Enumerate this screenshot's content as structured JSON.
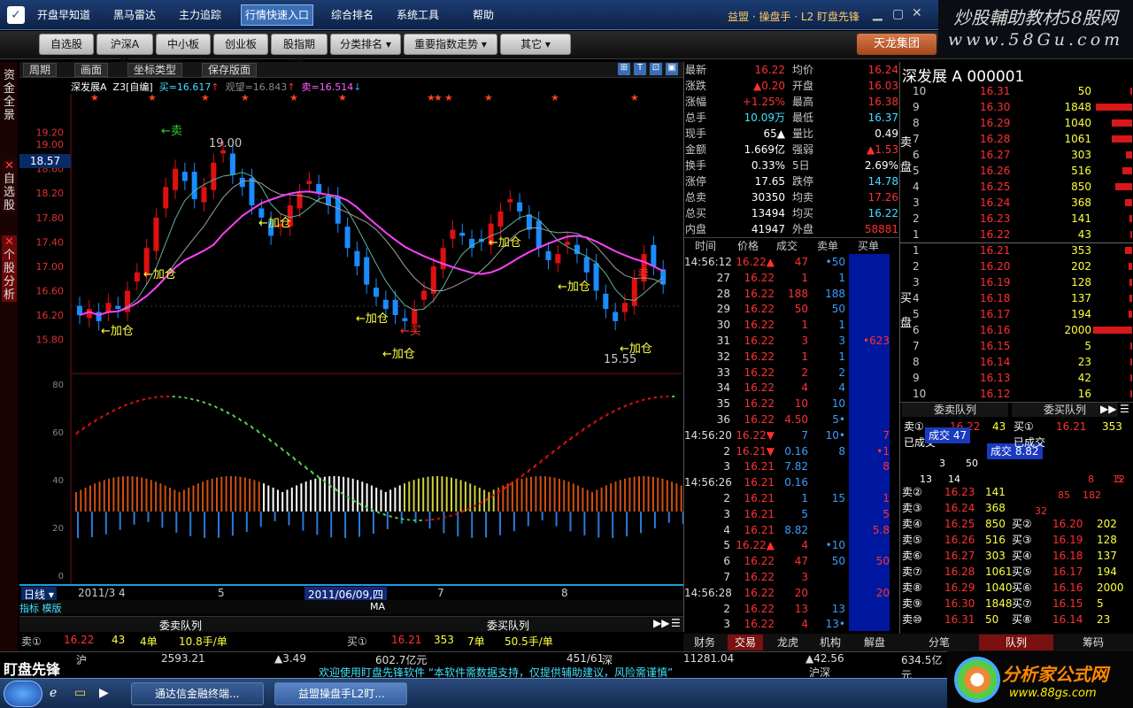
{
  "menu": {
    "items": [
      "开盘早知道",
      "黑马雷达",
      "主力追踪",
      "行情快速入口",
      "综合排名",
      "系统工具",
      "帮助"
    ],
    "active": "行情快速入口",
    "title": "益盟 · 操盘手 · L2 盯盘先锋"
  },
  "toolbar": {
    "buttons": [
      "自选股",
      "沪深A股",
      "中小板",
      "创业板",
      "股指期货",
      "分类排名 ▾",
      "重要指数走势 ▾",
      "其它 ▾"
    ],
    "brand": "天龙集团"
  },
  "watermark": {
    "line1": "炒股輔助教材58股网",
    "line2": "www.58Gu.com"
  },
  "side_tabs": [
    "资金全景",
    "自选股",
    "个股分析"
  ],
  "chart_bar": {
    "buttons": [
      "周期",
      "画面",
      "坐标类型",
      "保存版面"
    ]
  },
  "chart_info": {
    "name": "深发展A",
    "indicator": "Z3[自编]",
    "buy": "买=16.617",
    "watch": "观望=16.843",
    "sell": "卖=16.514"
  },
  "chart_data": {
    "type": "candlestick",
    "ylim": [
      15.3,
      19.8
    ],
    "yticks": [
      "19.20",
      "19.00",
      "18.80",
      "18.60",
      "18.40",
      "18.20",
      "18.00",
      "17.80",
      "17.60",
      "17.40",
      "17.20",
      "17.00",
      "16.80",
      "16.60",
      "16.40",
      "16.20",
      "16.00",
      "15.80",
      "15.60",
      "15.40"
    ],
    "price_label": "18.57",
    "annotations": [
      {
        "text": "←卖",
        "color": "#30d030"
      },
      {
        "text": "19.00",
        "color": "#c8c8c8"
      },
      {
        "text": "←加仓",
        "color": "#ffff40"
      },
      {
        "text": "←加仓",
        "color": "#ffff40"
      },
      {
        "text": "←加仓",
        "color": "#ffff40"
      },
      {
        "text": "←加仓",
        "color": "#ffff40"
      },
      {
        "text": "←加仓",
        "color": "#ffff40"
      },
      {
        "text": "←加仓",
        "color": "#ffff40"
      },
      {
        "text": "←加仓",
        "color": "#ffff40"
      },
      {
        "text": "←买",
        "color": "#ff3030"
      },
      {
        "text": "←加仓",
        "color": "#ffff40"
      },
      {
        "text": "15.55",
        "color": "#c8c8c8"
      },
      {
        "text": "卖",
        "color": "#ff3030"
      }
    ],
    "closes": [
      16.2,
      16.3,
      16.1,
      16.4,
      16.3,
      16.6,
      16.9,
      17.3,
      17.8,
      18.3,
      18.6,
      18.4,
      18.1,
      18.3,
      18.7,
      18.9,
      18.5,
      18.3,
      18.0,
      17.8,
      17.5,
      17.7,
      18.0,
      18.2,
      18.4,
      18.2,
      18.0,
      17.7,
      17.3,
      17.0,
      16.7,
      16.5,
      16.3,
      16.2,
      16.1,
      16.3,
      16.6,
      17.0,
      17.3,
      17.6,
      17.5,
      17.3,
      17.4,
      17.7,
      17.9,
      18.1,
      17.9,
      17.6,
      17.3,
      17.1,
      17.2,
      17.4,
      17.2,
      16.9,
      16.6,
      16.3,
      16.1,
      16.4,
      16.8,
      17.2,
      17.0,
      16.7
    ],
    "sub_yticks": [
      "80",
      "60",
      "40",
      "20",
      "0"
    ]
  },
  "date_bar": {
    "labels": [
      "日线 ▾",
      "2011/3",
      "4",
      "5",
      "2011/06/09,四",
      "7",
      "8"
    ]
  },
  "sub_bar": {
    "left": "指标 模版",
    "center": "MA"
  },
  "queue_bottom": {
    "sell_title": "委卖队列",
    "buy_title": "委买队列",
    "sell_row": [
      "卖①",
      "16.22",
      "43",
      "4单",
      "10.8手/单"
    ],
    "buy_row": [
      "买①",
      "16.21",
      "353",
      "7单",
      "50.5手/单"
    ]
  },
  "quote": {
    "rows": [
      {
        "k": "最新",
        "v": "16.22",
        "k2": "均价",
        "v2": "16.24"
      },
      {
        "k": "涨跌",
        "v": "▲0.20",
        "k2": "开盘",
        "v2": "16.03"
      },
      {
        "k": "涨幅",
        "v": "+1.25%",
        "k2": "最高",
        "v2": "16.38"
      },
      {
        "k": "总手",
        "v": "10.09万",
        "k2": "最低",
        "v2": "16.37"
      },
      {
        "k": "现手",
        "v": "65▲",
        "k2": "量比",
        "v2": "0.49"
      },
      {
        "k": "金额",
        "v": "1.669亿",
        "k2": "强弱",
        "v2": "▲1.53"
      },
      {
        "k": "换手",
        "v": "0.33%",
        "k2": "5日",
        "v2": "2.69%"
      },
      {
        "k": "涨停",
        "v": "17.65",
        "k2": "跌停",
        "v2": "14.78"
      },
      {
        "k": "总卖",
        "v": "30350",
        "k2": "均卖",
        "v2": "17.26"
      },
      {
        "k": "总买",
        "v": "13494",
        "k2": "均买",
        "v2": "16.22"
      },
      {
        "k": "内盘",
        "v": "41947",
        "k2": "外盘",
        "v2": "58881"
      }
    ]
  },
  "ticks": {
    "headers": [
      "时间",
      "价格",
      "成交",
      "卖单",
      "买单"
    ],
    "rows": [
      {
        "t": "14:56:12",
        "p": "16.22▲",
        "v": "47",
        "s": "•50",
        "b": ""
      },
      {
        "t": "27",
        "p": "16.22",
        "v": "1",
        "s": "1",
        "b": ""
      },
      {
        "t": "28",
        "p": "16.22",
        "v": "188",
        "s": "188",
        "b": ""
      },
      {
        "t": "29",
        "p": "16.22",
        "v": "50",
        "s": "50",
        "b": ""
      },
      {
        "t": "30",
        "p": "16.22",
        "v": "1",
        "s": "1",
        "b": ""
      },
      {
        "t": "31",
        "p": "16.22",
        "v": "3",
        "s": "3",
        "b": "•623"
      },
      {
        "t": "32",
        "p": "16.22",
        "v": "1",
        "s": "1",
        "b": ""
      },
      {
        "t": "33",
        "p": "16.22",
        "v": "2",
        "s": "2",
        "b": ""
      },
      {
        "t": "34",
        "p": "16.22",
        "v": "4",
        "s": "4",
        "b": ""
      },
      {
        "t": "35",
        "p": "16.22",
        "v": "10",
        "s": "10",
        "b": ""
      },
      {
        "t": "36",
        "p": "16.22",
        "v": "4.50",
        "s": "5•",
        "b": ""
      },
      {
        "t": "14:56:20",
        "p": "16.22▼",
        "v": "7",
        "s": "10•",
        "b": "7"
      },
      {
        "t": "2",
        "p": "16.21▼",
        "v": "0.16",
        "s": "8",
        "b": "•1"
      },
      {
        "t": "3",
        "p": "16.21",
        "v": "7.82",
        "s": "",
        "b": "8"
      },
      {
        "t": "14:56:26",
        "p": "16.21",
        "v": "0.16",
        "s": "",
        "b": ""
      },
      {
        "t": "2",
        "p": "16.21",
        "v": "1",
        "s": "15",
        "b": "1"
      },
      {
        "t": "3",
        "p": "16.21",
        "v": "5",
        "s": "",
        "b": "5"
      },
      {
        "t": "4",
        "p": "16.21",
        "v": "8.82",
        "s": "",
        "b": "5.8"
      },
      {
        "t": "5",
        "p": "16.22▲",
        "v": "4",
        "s": "•10",
        "b": ""
      },
      {
        "t": "6",
        "p": "16.22",
        "v": "47",
        "s": "50",
        "b": "50"
      },
      {
        "t": "7",
        "p": "16.22",
        "v": "3",
        "s": "",
        "b": ""
      },
      {
        "t": "14:56:28",
        "p": "16.22",
        "v": "20",
        "s": "",
        "b": "20"
      },
      {
        "t": "2",
        "p": "16.22",
        "v": "13",
        "s": "13",
        "b": ""
      },
      {
        "t": "3",
        "p": "16.22",
        "v": "4",
        "s": "13•",
        "b": ""
      }
    ]
  },
  "right_tabs": [
    "财务",
    "交易",
    "龙虎",
    "机构",
    "解盘"
  ],
  "book": {
    "title": "深发展 A 000001",
    "sell_label": "卖盘",
    "buy_label": "买盘",
    "sells": [
      {
        "n": "10",
        "p": "16.31",
        "q": "50"
      },
      {
        "n": "9",
        "p": "16.30",
        "q": "1848"
      },
      {
        "n": "8",
        "p": "16.29",
        "q": "1040"
      },
      {
        "n": "7",
        "p": "16.28",
        "q": "1061"
      },
      {
        "n": "6",
        "p": "16.27",
        "q": "303"
      },
      {
        "n": "5",
        "p": "16.26",
        "q": "516"
      },
      {
        "n": "4",
        "p": "16.25",
        "q": "850"
      },
      {
        "n": "3",
        "p": "16.24",
        "q": "368"
      },
      {
        "n": "2",
        "p": "16.23",
        "q": "141"
      },
      {
        "n": "1",
        "p": "16.22",
        "q": "43"
      }
    ],
    "buys": [
      {
        "n": "1",
        "p": "16.21",
        "q": "353"
      },
      {
        "n": "2",
        "p": "16.20",
        "q": "202"
      },
      {
        "n": "3",
        "p": "16.19",
        "q": "128"
      },
      {
        "n": "4",
        "p": "16.18",
        "q": "137"
      },
      {
        "n": "5",
        "p": "16.17",
        "q": "194"
      },
      {
        "n": "6",
        "p": "16.16",
        "q": "2000"
      },
      {
        "n": "7",
        "p": "16.15",
        "q": "5"
      },
      {
        "n": "8",
        "p": "16.14",
        "q": "23"
      },
      {
        "n": "9",
        "p": "16.13",
        "q": "42"
      },
      {
        "n": "10",
        "p": "16.12",
        "q": "16"
      }
    ]
  },
  "queue": {
    "sell_title": "委卖队列",
    "buy_title": "委买队列",
    "deal_sell": "成交 47",
    "deal_buy": "成交 8.82",
    "already": "已成交",
    "sell_rows": [
      {
        "k": "卖①",
        "p": "16.22",
        "q": "43"
      },
      {
        "k": "卖②",
        "p": "16.23",
        "q": "141"
      },
      {
        "k": "卖③",
        "p": "16.24",
        "q": "368"
      },
      {
        "k": "卖④",
        "p": "16.25",
        "q": "850"
      },
      {
        "k": "卖⑤",
        "p": "16.26",
        "q": "516"
      },
      {
        "k": "卖⑥",
        "p": "16.27",
        "q": "303"
      },
      {
        "k": "卖⑦",
        "p": "16.28",
        "q": "1061"
      },
      {
        "k": "卖⑧",
        "p": "16.29",
        "q": "1040"
      },
      {
        "k": "卖⑨",
        "p": "16.30",
        "q": "1848"
      },
      {
        "k": "卖⑩",
        "p": "16.31",
        "q": "50"
      }
    ],
    "buy_rows": [
      {
        "k": "买①",
        "p": "16.21",
        "q": "353"
      },
      {
        "k": "买②",
        "p": "16.20",
        "q": "202"
      },
      {
        "k": "买③",
        "p": "16.19",
        "q": "128"
      },
      {
        "k": "买④",
        "p": "16.18",
        "q": "137"
      },
      {
        "k": "买⑤",
        "p": "16.17",
        "q": "194"
      },
      {
        "k": "买⑥",
        "p": "16.16",
        "q": "2000"
      },
      {
        "k": "买⑦",
        "p": "16.15",
        "q": "5"
      },
      {
        "k": "买⑧",
        "p": "16.14",
        "q": "23"
      }
    ],
    "mini": [
      "3",
      "50",
      "13",
      "14",
      "85",
      "182",
      "5",
      "32",
      "8",
      "12"
    ]
  },
  "bottom_tabs": [
    "分笔",
    "队列",
    "筹码"
  ],
  "status": {
    "brand": "盯盘先锋",
    "sh": "沪",
    "sh_idx": "2593.21",
    "sh_chg": "▲3.49",
    "sh_amt": "602.7亿元",
    "sh_ratio": "451/61",
    "sz": "深",
    "sz_idx": "11281.04",
    "sz_chg": "▲42.56",
    "sz_amt": "634.5亿元",
    "ticker": "欢迎使用盯盘先锋软件      “本软件需数据支持，仅提供辅助建议，风险需谨慎”",
    "hs": "沪深"
  },
  "taskbar": {
    "tasks": [
      "通达信金融终端...",
      "益盟操盘手L2盯..."
    ]
  },
  "logo2": {
    "t1": "分析家公式网",
    "t2": "www.88gs.com"
  }
}
